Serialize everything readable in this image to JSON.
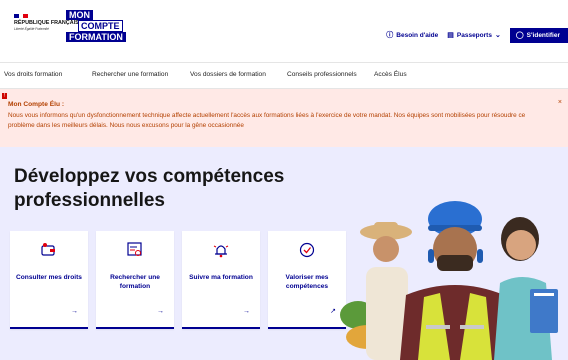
{
  "header": {
    "gov_logo_text": "RÉPUBLIQUE FRANÇAISE",
    "gov_motto": "Liberté Égalité Fraternité",
    "brand_lines": [
      "MON",
      "COMPTE",
      "FORMATION"
    ],
    "help_link": "Besoin d'aide",
    "passports_link": "Passeports",
    "login_button": "S'identifier",
    "icons": [
      "help-circle-icon",
      "passport-icon",
      "chevron-down-icon",
      "user-icon"
    ]
  },
  "nav": {
    "items": [
      "Vos droits formation",
      "Rechercher une formation",
      "Vos dossiers de formation",
      "Conseils professionnels",
      "Accès Élus"
    ]
  },
  "alert": {
    "badge": "!",
    "title": "Mon Compte Élu :",
    "message": "Nous vous informons qu'un dysfonctionnement technique affecte actuellement l'accès aux formations liées à l'exercice de votre mandat. Nos équipes sont mobilisées pour résoudre ce problème dans les meilleurs délais. Nous nous excusons pour la gêne occasionnée",
    "close": "×"
  },
  "hero": {
    "title": "Développez vos compétences professionnelles",
    "cards": [
      {
        "label": "Consulter mes droits",
        "icon": "wallet-icon",
        "arrow": "→"
      },
      {
        "label": "Rechercher une formation",
        "icon": "search-document-icon",
        "arrow": "→"
      },
      {
        "label": "Suivre ma formation",
        "icon": "bell-icon",
        "arrow": "→"
      },
      {
        "label": "Valoriser mes compétences",
        "icon": "check-circle-icon",
        "arrow": "↗"
      }
    ]
  },
  "colors": {
    "brand_blue": "#000091",
    "alert_bg": "#ffe9e6",
    "alert_text": "#b34000",
    "hero_bg": "#ececfe"
  }
}
